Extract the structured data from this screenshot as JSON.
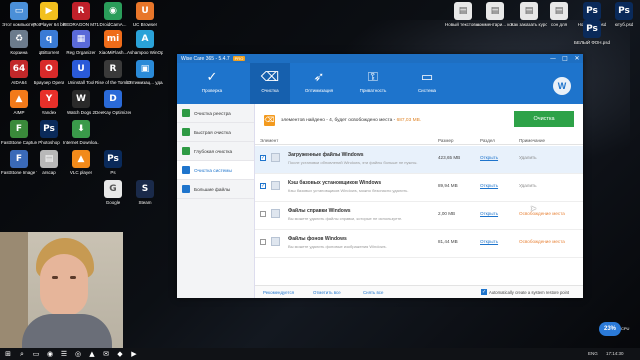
{
  "desktop": {
    "icons": [
      {
        "label": "Этот компьютер",
        "color": "#4a8fd8",
        "glyph": "▭"
      },
      {
        "label": "PotPlayer 64 bit",
        "color": "#f2c01e",
        "glyph": "▶"
      },
      {
        "label": "REDRAGON M711-FPS",
        "color": "#c0202a",
        "glyph": "R"
      },
      {
        "label": "DroidCamA...",
        "color": "#2a9d5a",
        "glyph": "◉"
      },
      {
        "label": "UC Browser",
        "color": "#e8762a",
        "glyph": "U"
      },
      {
        "label": "Корзина",
        "color": "#6b7b8c",
        "glyph": "♻"
      },
      {
        "label": "qBittorrent",
        "color": "#3a7bd5",
        "glyph": "q"
      },
      {
        "label": "Reg Organizer",
        "color": "#5a6ad8",
        "glyph": "▦"
      },
      {
        "label": "XiaoMiFlash...",
        "color": "#ef6c1a",
        "glyph": "mi"
      },
      {
        "label": "Ashampoo WinOptimi...",
        "color": "#2aa2d8",
        "glyph": "A"
      },
      {
        "label": "AIDA64",
        "color": "#c2282a",
        "glyph": "64"
      },
      {
        "label": "Браузер Opera",
        "color": "#d82a2a",
        "glyph": "O"
      },
      {
        "label": "Uninstall Tool",
        "color": "#2a5ad8",
        "glyph": "U"
      },
      {
        "label": "Rise of the Tomb Raider",
        "color": "#3a3a3a",
        "glyph": "R"
      },
      {
        "label": "Оптимизац... удаленный",
        "color": "#2a8ad8",
        "glyph": "▣"
      },
      {
        "label": "AIMP",
        "color": "#f27a1a",
        "glyph": "▲"
      },
      {
        "label": "Yandex",
        "color": "#e8302a",
        "glyph": "Y"
      },
      {
        "label": "Watch Dogs 2",
        "color": "#2a2a2a",
        "glyph": "W"
      },
      {
        "label": "DeeKay Optimizer",
        "color": "#2a6ad8",
        "glyph": "D"
      },
      {
        "label": "FastStone Capture",
        "color": "#3a8a3a",
        "glyph": "F"
      },
      {
        "label": "Photoshop",
        "color": "#0a2a5a",
        "glyph": "Ps"
      },
      {
        "label": "Internet Downloa...",
        "color": "#3a9a4a",
        "glyph": "⬇"
      },
      {
        "label": "FastStone Image Viewer",
        "color": "#3a6ab8",
        "glyph": "F"
      },
      {
        "label": "arscap",
        "color": "#b8b8b8",
        "glyph": "▤"
      },
      {
        "label": "VLC player",
        "color": "#f28a1a",
        "glyph": "▲"
      },
      {
        "label": "Ps",
        "color": "#0a2a5a",
        "glyph": "Ps"
      },
      {
        "label": "Google",
        "color": "#e8e8e8",
        "glyph": "G"
      },
      {
        "label": "Steam",
        "color": "#1a2a4a",
        "glyph": "S"
      },
      {
        "label": "Новый текстовы...",
        "color": "#e8e8e8",
        "glyph": "▤"
      },
      {
        "label": "комментари... конкурс",
        "color": "#e8e8e8",
        "glyph": "▤"
      },
      {
        "label": "Как заказать курсив мой",
        "color": "#e8e8e8",
        "glyph": "▤"
      },
      {
        "label": "сон для",
        "color": "#e8e8e8",
        "glyph": "▤"
      },
      {
        "label": "Новый 4...psd",
        "color": "#0a2a5a",
        "glyph": "Ps"
      },
      {
        "label": "БЕЛЫЙ ФОН.psd",
        "color": "#0a2a5a",
        "glyph": "Ps"
      },
      {
        "label": "ютуб.psd",
        "color": "#0a2a5a",
        "glyph": "Ps"
      }
    ]
  },
  "window": {
    "title": "Wise Care 365 - 5.4.7",
    "badge": "PRO",
    "controls": {
      "minimize": "—",
      "maximize": "□",
      "close": "✕"
    },
    "toolbar": [
      {
        "label": "Проверка",
        "icon": "check-icon",
        "glyph": "✓"
      },
      {
        "label": "Очистка",
        "icon": "broom-icon",
        "glyph": "⌫"
      },
      {
        "label": "Оптимизация",
        "icon": "rocket-icon",
        "glyph": "➶"
      },
      {
        "label": "Приватность",
        "icon": "lock-icon",
        "glyph": "⚿"
      },
      {
        "label": "Система",
        "icon": "monitor-icon",
        "glyph": "▭"
      }
    ],
    "logo": "W",
    "sidebar": [
      {
        "label": "Очистка реестра",
        "color": "#2e9a44"
      },
      {
        "label": "Быстрая очистка",
        "color": "#2e9a44"
      },
      {
        "label": "Глубокая очистка",
        "color": "#2e9a44"
      },
      {
        "label": "Очистка системы",
        "color": "#1e74cc"
      },
      {
        "label": "Большие файлы",
        "color": "#1e74cc"
      }
    ],
    "banner": {
      "text_prefix": "элементов найдено - 4, будет освобождено места - ",
      "size": "687,03 MB."
    },
    "clean_button": "Очистка",
    "table": {
      "headers": {
        "element": "Элемент",
        "size": "Размер",
        "section": "Раздел",
        "note": "Примечание"
      },
      "rows": [
        {
          "checked": true,
          "name": "Загруженные файлы Windows",
          "desc": "После установки обновлений Windows, эти файлы больше не нужны.",
          "size": "423,65 MB",
          "view": "Открыть",
          "note": "Удалить",
          "note_orange": false
        },
        {
          "checked": true,
          "name": "Кэш базовых установщиков Windows",
          "desc": "Кэш базовых установщиков Windows, можно безопасно удалить.",
          "size": "89,94 MB",
          "view": "Открыть",
          "note": "Удалить",
          "note_orange": false
        },
        {
          "checked": false,
          "name": "Файлы справки Windows",
          "desc": "Вы можете удалить файлы справки, которые не используете.",
          "size": "2,00 MB",
          "view": "Открыть",
          "note": "Освобождение места",
          "note_orange": true
        },
        {
          "checked": false,
          "name": "Файлы фонов Windows",
          "desc": "Вы можете удалить фоновые изображения Windows.",
          "size": "81,44 MB",
          "view": "Открыть",
          "note": "Освобождение места",
          "note_orange": true
        }
      ]
    },
    "footer": {
      "recommended": "Рекомендуется",
      "check_all": "Отметить все",
      "uncheck_all": "Снять все",
      "restore_label": "Automatically create a system restore point"
    }
  },
  "widget": {
    "cpu": "23%",
    "cpu_label": "CPU"
  },
  "taskbar": {
    "tray_lang": "ENG",
    "clock": "17:14:30",
    "apps": [
      "⊞",
      "⌕",
      "▭",
      "◉",
      "☰",
      "◎",
      "▲",
      "✉",
      "◆",
      "▶"
    ]
  }
}
